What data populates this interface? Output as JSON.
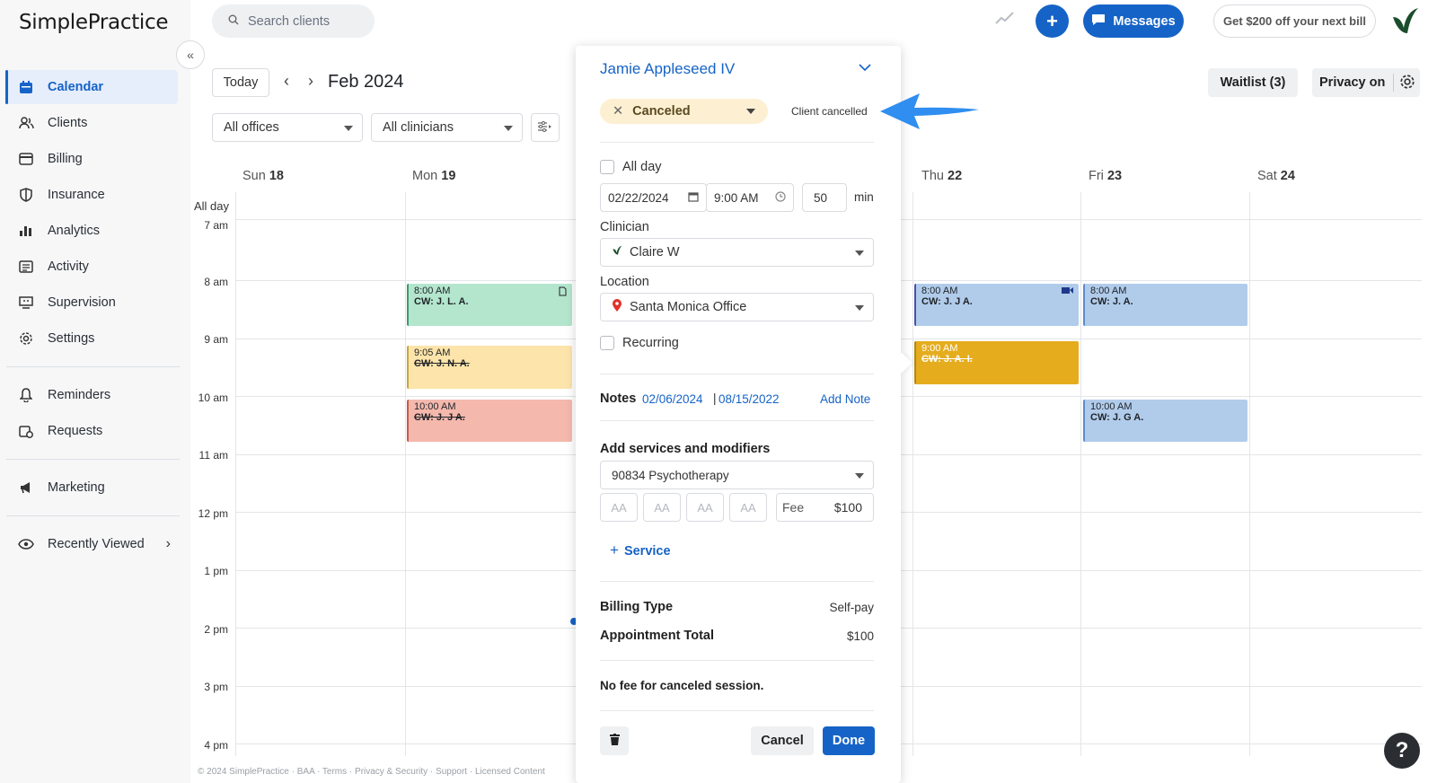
{
  "app": {
    "logo_text": "SimplePractice"
  },
  "sidebar": {
    "items": [
      {
        "label": "Calendar",
        "icon": "calendar-icon",
        "active": true
      },
      {
        "label": "Clients",
        "icon": "users-icon"
      },
      {
        "label": "Billing",
        "icon": "credit-card-icon"
      },
      {
        "label": "Insurance",
        "icon": "shield-icon"
      },
      {
        "label": "Analytics",
        "icon": "bar-chart-icon"
      },
      {
        "label": "Activity",
        "icon": "list-icon"
      },
      {
        "label": "Supervision",
        "icon": "supervision-icon"
      },
      {
        "label": "Settings",
        "icon": "gear-icon"
      }
    ],
    "secondary": [
      {
        "label": "Reminders",
        "icon": "bell-icon"
      },
      {
        "label": "Requests",
        "icon": "calendar-request-icon"
      }
    ],
    "marketing": {
      "label": "Marketing",
      "icon": "megaphone-icon"
    },
    "recently_viewed": {
      "label": "Recently Viewed",
      "icon": "eye-icon"
    }
  },
  "topbar": {
    "search_placeholder": "Search clients",
    "messages_label": "Messages",
    "promo_label": "Get $200 off your next bill"
  },
  "calendar": {
    "today_label": "Today",
    "month_label": "Feb 2024",
    "offices_select": "All offices",
    "clinicians_select": "All clinicians",
    "waitlist_label": "Waitlist (3)",
    "privacy_label": "Privacy on",
    "allday_label": "All day",
    "days": [
      {
        "name": "Sun",
        "num": "18"
      },
      {
        "name": "Mon",
        "num": "19"
      },
      {
        "name": "Thu",
        "num": "22"
      },
      {
        "name": "Fri",
        "num": "23"
      },
      {
        "name": "Sat",
        "num": "24"
      }
    ],
    "hours": [
      "7 am",
      "8 am",
      "9 am",
      "10 am",
      "11 am",
      "12 pm",
      "1 pm",
      "2 pm",
      "3 pm",
      "4 pm"
    ],
    "events": [
      {
        "time": "8:00 AM",
        "name": "CW: J. L. A.",
        "color": "#b3e6cd",
        "border": "#3a9a6f",
        "strike": false
      },
      {
        "time": "9:05 AM",
        "name": "CW: J. N. A.",
        "color": "#fde4aa",
        "border": "#c9a53d",
        "strike": true
      },
      {
        "time": "10:00 AM",
        "name": "CW: J. J A.",
        "color": "#f5b8ad",
        "border": "#c9584a",
        "strike": true
      },
      {
        "time": "8:00 AM",
        "name": "CW: J. J A.",
        "color": "#b1cceb",
        "border": "#4a4fa8",
        "strike": false
      },
      {
        "time": "9:00 AM",
        "name": "CW: J. A. I.",
        "color": "#e5ad1e",
        "border": "#b58612",
        "strike": true
      },
      {
        "time": "8:00 AM",
        "name": "CW: J. A.",
        "color": "#b1cceb",
        "border": "#5d8ccc",
        "strike": false
      },
      {
        "time": "10:00 AM",
        "name": "CW: J. G A.",
        "color": "#b1cceb",
        "border": "#5d8ccc",
        "strike": false
      }
    ]
  },
  "footer": {
    "text": "© 2024 SimplePractice · BAA · Terms · Privacy & Security · Support · Licensed Content"
  },
  "popover": {
    "client_name": "Jamie Appleseed IV",
    "status": "Canceled",
    "status_note": "Client cancelled",
    "all_day_label": "All day",
    "date": "02/22/2024",
    "time": "9:00 AM",
    "duration": "50",
    "duration_unit": "min",
    "clinician_label": "Clinician",
    "clinician": "Claire W",
    "location_label": "Location",
    "location": "Santa Monica Office",
    "recurring_label": "Recurring",
    "notes_label": "Notes",
    "note_dates": [
      "02/06/2024",
      "08/15/2022"
    ],
    "note_separator": "|",
    "add_note_label": "Add Note",
    "services_title": "Add services and modifiers",
    "service": "90834 Psychotherapy",
    "modifiers": [
      "AA",
      "AA",
      "AA",
      "AA"
    ],
    "fee_label": "Fee",
    "fee_value": "$100",
    "add_service_label": "Service",
    "billing_type_label": "Billing Type",
    "billing_type_value": "Self-pay",
    "appointment_total_label": "Appointment Total",
    "appointment_total_value": "$100",
    "no_fee_text": "No fee for canceled session.",
    "cancel_label": "Cancel",
    "done_label": "Done"
  },
  "colors": {
    "accent": "#1663c7",
    "canceled_pill": "#fdf0d2",
    "annotation_arrow": "#2f8ef0"
  }
}
